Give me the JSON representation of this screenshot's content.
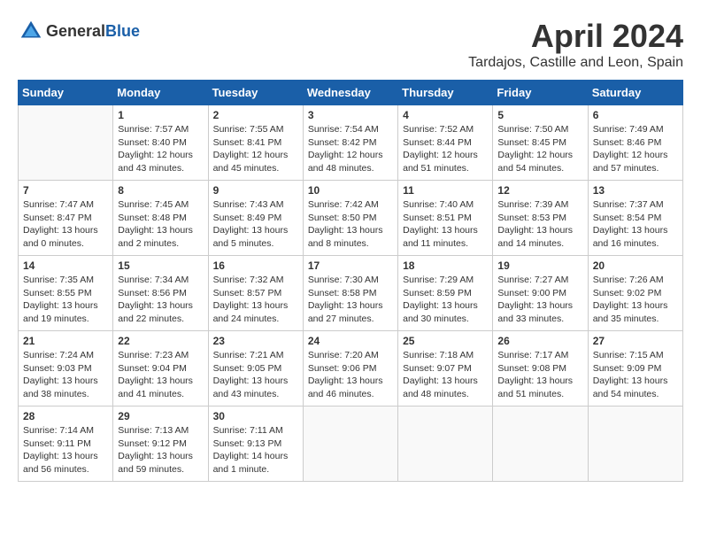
{
  "header": {
    "logo_general": "General",
    "logo_blue": "Blue",
    "month_title": "April 2024",
    "location": "Tardajos, Castille and Leon, Spain"
  },
  "days_of_week": [
    "Sunday",
    "Monday",
    "Tuesday",
    "Wednesday",
    "Thursday",
    "Friday",
    "Saturday"
  ],
  "weeks": [
    [
      {
        "day": "",
        "sunrise": "",
        "sunset": "",
        "daylight": ""
      },
      {
        "day": "1",
        "sunrise": "Sunrise: 7:57 AM",
        "sunset": "Sunset: 8:40 PM",
        "daylight": "Daylight: 12 hours and 43 minutes."
      },
      {
        "day": "2",
        "sunrise": "Sunrise: 7:55 AM",
        "sunset": "Sunset: 8:41 PM",
        "daylight": "Daylight: 12 hours and 45 minutes."
      },
      {
        "day": "3",
        "sunrise": "Sunrise: 7:54 AM",
        "sunset": "Sunset: 8:42 PM",
        "daylight": "Daylight: 12 hours and 48 minutes."
      },
      {
        "day": "4",
        "sunrise": "Sunrise: 7:52 AM",
        "sunset": "Sunset: 8:44 PM",
        "daylight": "Daylight: 12 hours and 51 minutes."
      },
      {
        "day": "5",
        "sunrise": "Sunrise: 7:50 AM",
        "sunset": "Sunset: 8:45 PM",
        "daylight": "Daylight: 12 hours and 54 minutes."
      },
      {
        "day": "6",
        "sunrise": "Sunrise: 7:49 AM",
        "sunset": "Sunset: 8:46 PM",
        "daylight": "Daylight: 12 hours and 57 minutes."
      }
    ],
    [
      {
        "day": "7",
        "sunrise": "Sunrise: 7:47 AM",
        "sunset": "Sunset: 8:47 PM",
        "daylight": "Daylight: 13 hours and 0 minutes."
      },
      {
        "day": "8",
        "sunrise": "Sunrise: 7:45 AM",
        "sunset": "Sunset: 8:48 PM",
        "daylight": "Daylight: 13 hours and 2 minutes."
      },
      {
        "day": "9",
        "sunrise": "Sunrise: 7:43 AM",
        "sunset": "Sunset: 8:49 PM",
        "daylight": "Daylight: 13 hours and 5 minutes."
      },
      {
        "day": "10",
        "sunrise": "Sunrise: 7:42 AM",
        "sunset": "Sunset: 8:50 PM",
        "daylight": "Daylight: 13 hours and 8 minutes."
      },
      {
        "day": "11",
        "sunrise": "Sunrise: 7:40 AM",
        "sunset": "Sunset: 8:51 PM",
        "daylight": "Daylight: 13 hours and 11 minutes."
      },
      {
        "day": "12",
        "sunrise": "Sunrise: 7:39 AM",
        "sunset": "Sunset: 8:53 PM",
        "daylight": "Daylight: 13 hours and 14 minutes."
      },
      {
        "day": "13",
        "sunrise": "Sunrise: 7:37 AM",
        "sunset": "Sunset: 8:54 PM",
        "daylight": "Daylight: 13 hours and 16 minutes."
      }
    ],
    [
      {
        "day": "14",
        "sunrise": "Sunrise: 7:35 AM",
        "sunset": "Sunset: 8:55 PM",
        "daylight": "Daylight: 13 hours and 19 minutes."
      },
      {
        "day": "15",
        "sunrise": "Sunrise: 7:34 AM",
        "sunset": "Sunset: 8:56 PM",
        "daylight": "Daylight: 13 hours and 22 minutes."
      },
      {
        "day": "16",
        "sunrise": "Sunrise: 7:32 AM",
        "sunset": "Sunset: 8:57 PM",
        "daylight": "Daylight: 13 hours and 24 minutes."
      },
      {
        "day": "17",
        "sunrise": "Sunrise: 7:30 AM",
        "sunset": "Sunset: 8:58 PM",
        "daylight": "Daylight: 13 hours and 27 minutes."
      },
      {
        "day": "18",
        "sunrise": "Sunrise: 7:29 AM",
        "sunset": "Sunset: 8:59 PM",
        "daylight": "Daylight: 13 hours and 30 minutes."
      },
      {
        "day": "19",
        "sunrise": "Sunrise: 7:27 AM",
        "sunset": "Sunset: 9:00 PM",
        "daylight": "Daylight: 13 hours and 33 minutes."
      },
      {
        "day": "20",
        "sunrise": "Sunrise: 7:26 AM",
        "sunset": "Sunset: 9:02 PM",
        "daylight": "Daylight: 13 hours and 35 minutes."
      }
    ],
    [
      {
        "day": "21",
        "sunrise": "Sunrise: 7:24 AM",
        "sunset": "Sunset: 9:03 PM",
        "daylight": "Daylight: 13 hours and 38 minutes."
      },
      {
        "day": "22",
        "sunrise": "Sunrise: 7:23 AM",
        "sunset": "Sunset: 9:04 PM",
        "daylight": "Daylight: 13 hours and 41 minutes."
      },
      {
        "day": "23",
        "sunrise": "Sunrise: 7:21 AM",
        "sunset": "Sunset: 9:05 PM",
        "daylight": "Daylight: 13 hours and 43 minutes."
      },
      {
        "day": "24",
        "sunrise": "Sunrise: 7:20 AM",
        "sunset": "Sunset: 9:06 PM",
        "daylight": "Daylight: 13 hours and 46 minutes."
      },
      {
        "day": "25",
        "sunrise": "Sunrise: 7:18 AM",
        "sunset": "Sunset: 9:07 PM",
        "daylight": "Daylight: 13 hours and 48 minutes."
      },
      {
        "day": "26",
        "sunrise": "Sunrise: 7:17 AM",
        "sunset": "Sunset: 9:08 PM",
        "daylight": "Daylight: 13 hours and 51 minutes."
      },
      {
        "day": "27",
        "sunrise": "Sunrise: 7:15 AM",
        "sunset": "Sunset: 9:09 PM",
        "daylight": "Daylight: 13 hours and 54 minutes."
      }
    ],
    [
      {
        "day": "28",
        "sunrise": "Sunrise: 7:14 AM",
        "sunset": "Sunset: 9:11 PM",
        "daylight": "Daylight: 13 hours and 56 minutes."
      },
      {
        "day": "29",
        "sunrise": "Sunrise: 7:13 AM",
        "sunset": "Sunset: 9:12 PM",
        "daylight": "Daylight: 13 hours and 59 minutes."
      },
      {
        "day": "30",
        "sunrise": "Sunrise: 7:11 AM",
        "sunset": "Sunset: 9:13 PM",
        "daylight": "Daylight: 14 hours and 1 minute."
      },
      {
        "day": "",
        "sunrise": "",
        "sunset": "",
        "daylight": ""
      },
      {
        "day": "",
        "sunrise": "",
        "sunset": "",
        "daylight": ""
      },
      {
        "day": "",
        "sunrise": "",
        "sunset": "",
        "daylight": ""
      },
      {
        "day": "",
        "sunrise": "",
        "sunset": "",
        "daylight": ""
      }
    ]
  ]
}
